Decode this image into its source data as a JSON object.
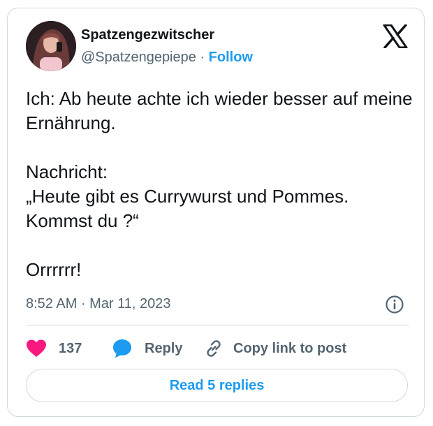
{
  "author": {
    "name": "Spatzengezwitscher",
    "handle": "@Spatzengepiepe",
    "separator": "·",
    "follow_label": "Follow"
  },
  "tweet": {
    "text": "Ich: Ab heute achte ich wieder besser auf meine Ernährung.\n\nNachricht:\n„Heute gibt es Currywurst und Pommes. Kommst du ?“\n\nOrrrrrr!",
    "timestamp": "8:52 AM · Mar 11, 2023"
  },
  "actions": {
    "like_count": "137",
    "reply_label": "Reply",
    "copy_label": "Copy link to post"
  },
  "read_replies_label": "Read 5 replies",
  "colors": {
    "accent": "#1d9bf0",
    "like": "#f91880",
    "border": "#cfd9de",
    "muted": "#536471",
    "text": "#0f1419"
  },
  "icons": [
    "x-logo-icon",
    "info-icon",
    "heart-icon",
    "reply-bubble-icon",
    "link-icon"
  ]
}
